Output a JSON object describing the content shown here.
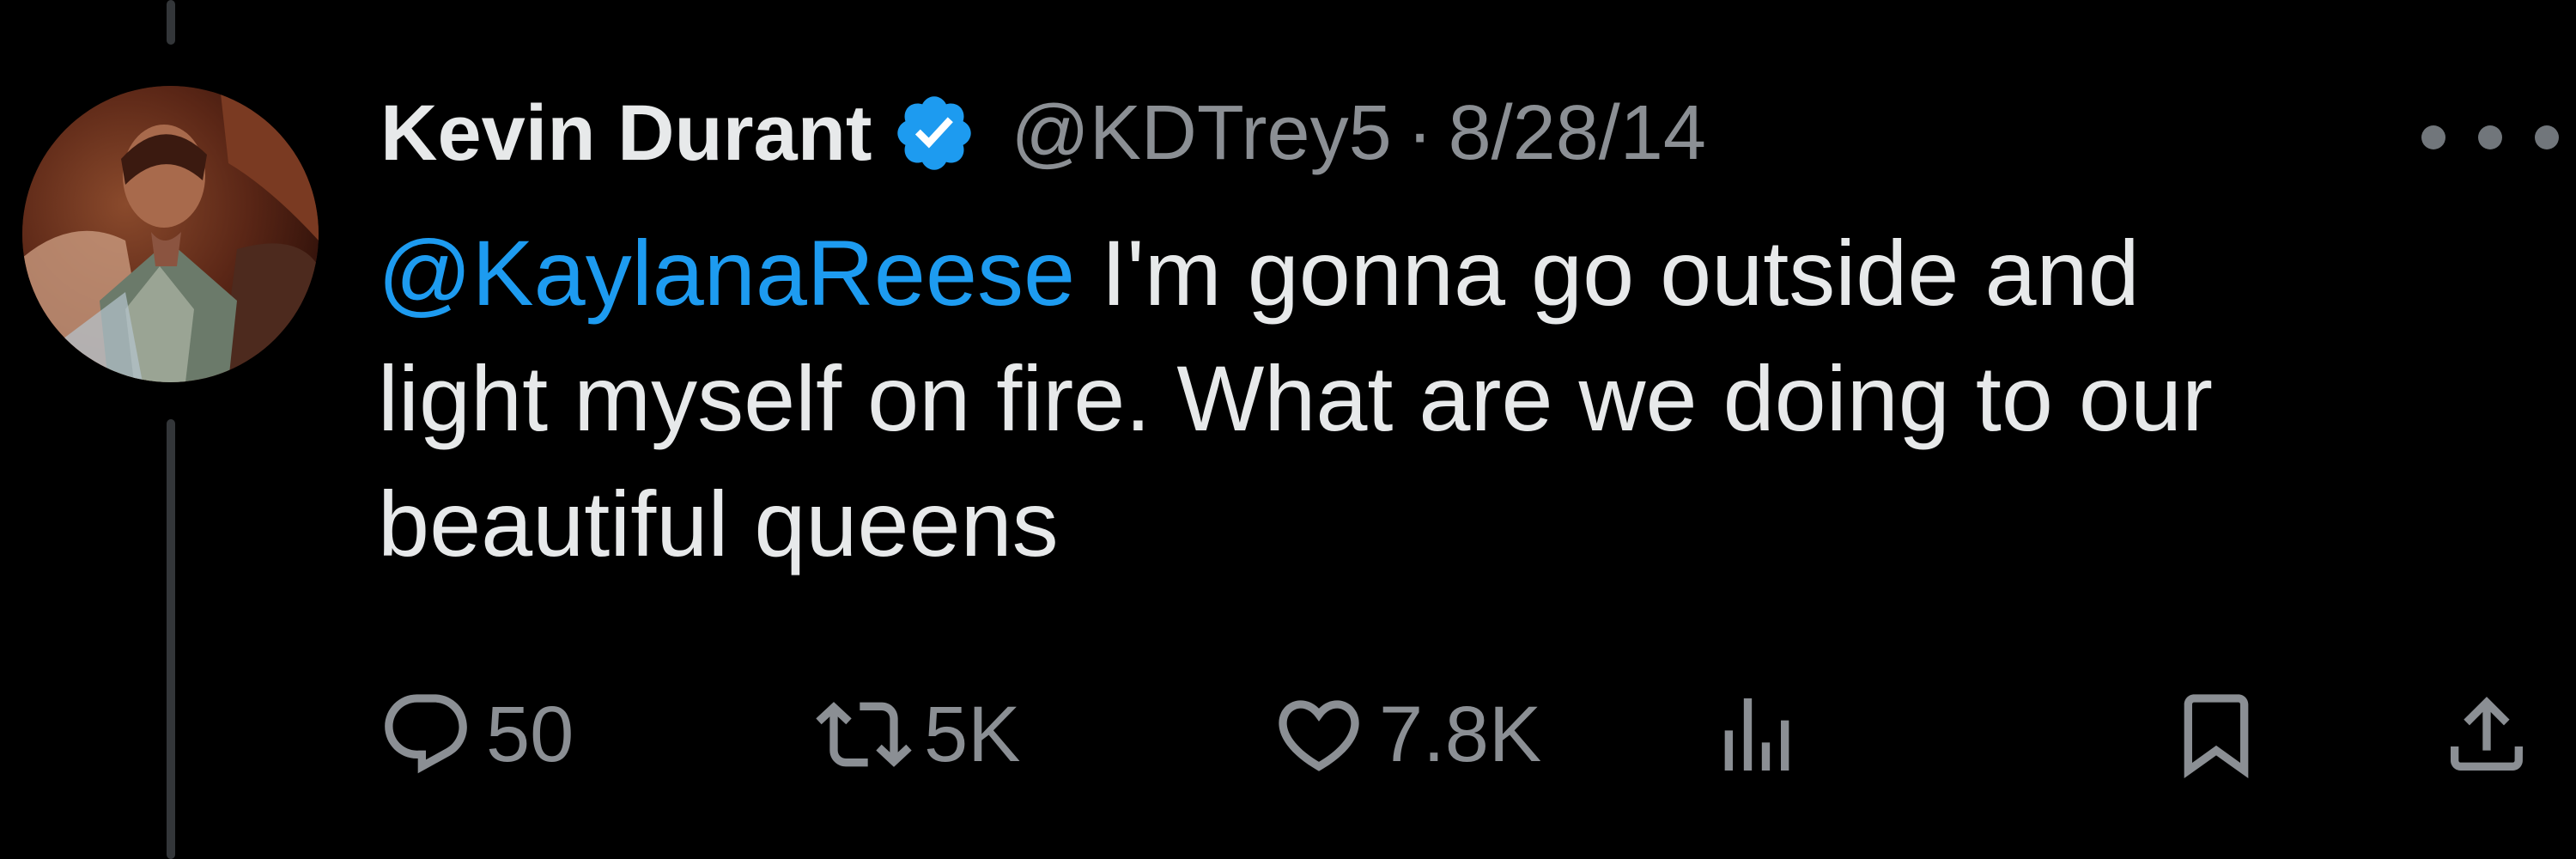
{
  "author": {
    "name": "Kevin Durant",
    "handle": "@KDTrey5",
    "separator": "·",
    "date": "8/28/14",
    "verified_color": "#1d9bf0"
  },
  "tweet": {
    "mention": "@KaylanaReese",
    "line1_rest": " I'm gonna go outside and",
    "line2": "light myself on fire. What are we doing to our",
    "line3": "beautiful queens"
  },
  "actions": {
    "reply_count": "50",
    "retweet_count": "5K",
    "like_count": "7.8K"
  },
  "icons": {
    "reply": "reply-bubble-icon",
    "retweet": "retweet-icon",
    "like": "heart-icon",
    "views": "views-bar-chart-icon",
    "bookmark": "bookmark-icon",
    "share": "share-icon",
    "more": "more-options-icon"
  },
  "colors": {
    "background": "#000000",
    "text": "#e7e9ea",
    "muted": "#8b8f94",
    "link": "#1d9bf0"
  }
}
